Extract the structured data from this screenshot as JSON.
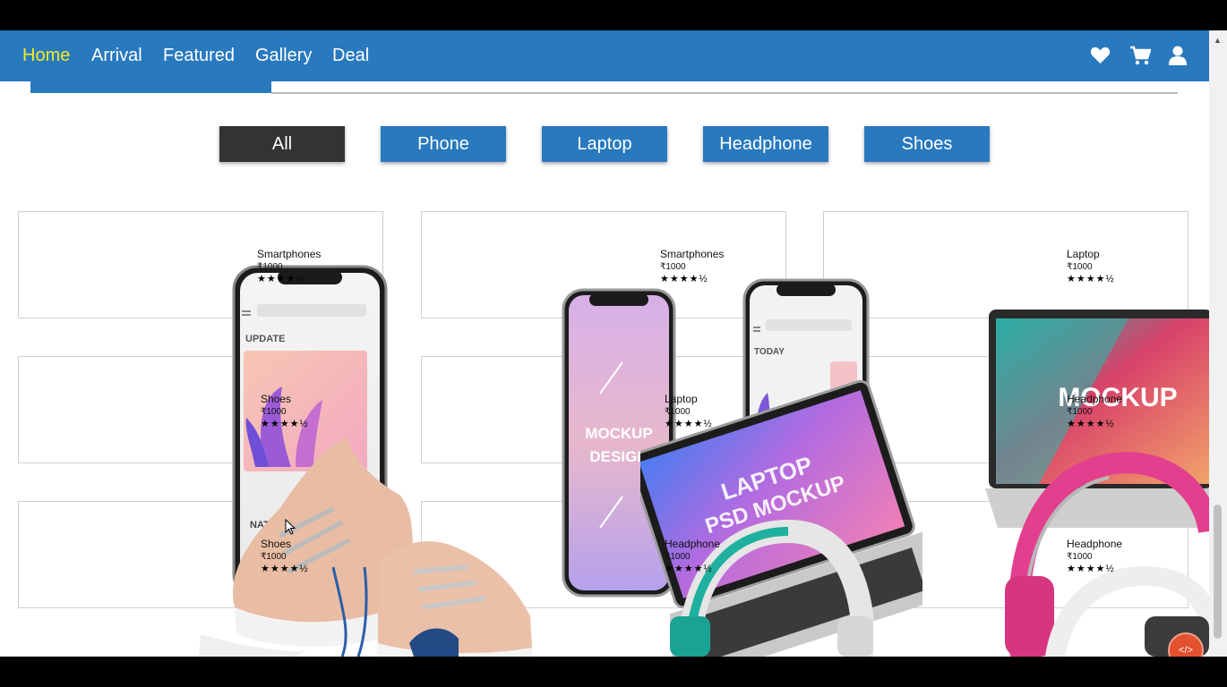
{
  "nav": {
    "links": [
      "Home",
      "Arrival",
      "Featured",
      "Gallery",
      "Deal"
    ],
    "active_color": "#f2ea26",
    "bar_color": "#2879be",
    "icons": [
      "heart-icon",
      "cart-icon",
      "user-icon"
    ]
  },
  "filters": {
    "items": [
      "All",
      "Phone",
      "Laptop",
      "Headphone",
      "Shoes"
    ],
    "active": "All",
    "active_color": "#333333"
  },
  "products": [
    {
      "name": "Smartphones",
      "price": "₹1000",
      "rating": "★★★★½"
    },
    {
      "name": "Smartphones",
      "price": "₹1000",
      "rating": "★★★★½"
    },
    {
      "name": "Laptop",
      "price": "₹1000",
      "rating": "★★★★½"
    },
    {
      "name": "Shoes",
      "price": "₹1000",
      "rating": "★★★★½"
    },
    {
      "name": "Laptop",
      "price": "₹1000",
      "rating": "★★★★½"
    },
    {
      "name": "Headphone",
      "price": "₹1000",
      "rating": "★★★★½"
    },
    {
      "name": "Shoes",
      "price": "₹1000",
      "rating": "★★★★½"
    },
    {
      "name": "Headphone",
      "price": "₹1000",
      "rating": "★★★★½"
    },
    {
      "name": "Headphone",
      "price": "₹1000",
      "rating": "★★★★½"
    }
  ],
  "mockup_text": {
    "phone1_update": "UPDATE",
    "phone1_bottom": "NAT",
    "phone2_line1": "MOCKUP",
    "phone2_line2": "DESIGN",
    "phone3_today": "TODAY",
    "laptop1_line1": "LAPTOP",
    "laptop1_line2": "PSD MOCKUP",
    "laptop2_text": "MOCKUP"
  },
  "fab_label": "</>"
}
